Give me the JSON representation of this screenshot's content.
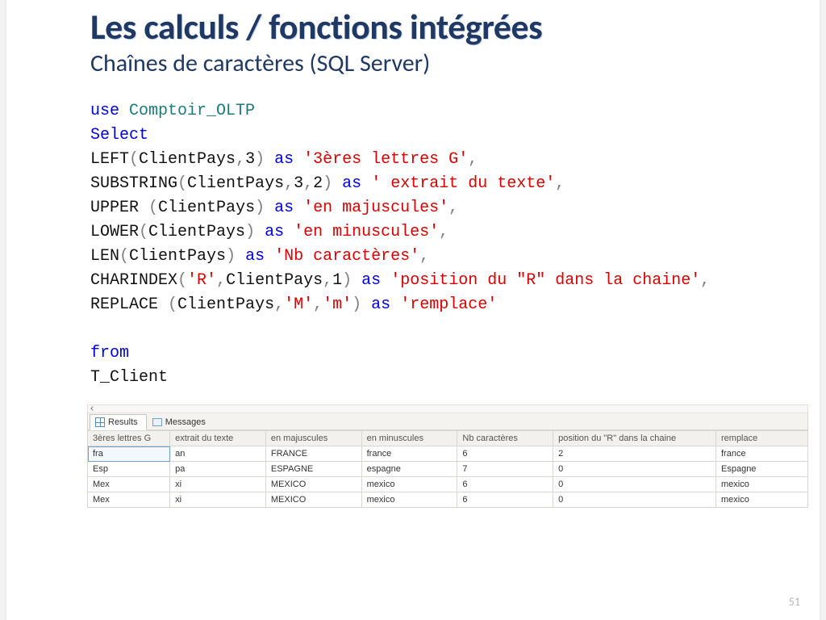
{
  "title": "Les calculs / fonctions intégrées",
  "subtitle": "Chaînes de caractères (SQL Server)",
  "page_number": "51",
  "sql": {
    "use_kw": "use",
    "db": "Comptoir_OLTP",
    "select_kw": "Select",
    "left_fn": "LEFT",
    "col": "ClientPays",
    "n3": "3",
    "as_kw": "as",
    "alias1": "'3ères lettres G'",
    "substr_fn": "SUBSTRING",
    "n3b": "3",
    "n2": "2",
    "alias2": "' extrait du texte'",
    "upper_fn": "UPPER",
    "alias3": "'en majuscules'",
    "lower_fn": "LOWER",
    "alias4": "'en minuscules'",
    "len_fn": "LEN",
    "alias5": "'Nb caractères'",
    "charidx_fn": "CHARINDEX",
    "r_lit": "'R'",
    "n1": "1",
    "alias6": "'position du \"R\" dans la chaine'",
    "replace_fn": "REPLACE",
    "m_up": "'M'",
    "m_lo": "'m'",
    "alias7": "'remplace'",
    "from_kw": "from",
    "table": "T_Client"
  },
  "tabs": {
    "results": "Results",
    "messages": "Messages"
  },
  "grid": {
    "headers": [
      "3ères lettres G",
      "extrait du texte",
      "en majuscules",
      "en minuscules",
      "Nb caractères",
      "position du \"R\" dans la chaine",
      "remplace"
    ],
    "rows": [
      [
        "fra",
        "an",
        "FRANCE",
        "france",
        "6",
        "2",
        "france"
      ],
      [
        "Esp",
        "pa",
        "ESPAGNE",
        "espagne",
        "7",
        "0",
        "Espagne"
      ],
      [
        "Mex",
        "xi",
        "MEXICO",
        "mexico",
        "6",
        "0",
        "mexico"
      ],
      [
        "Mex",
        "xi",
        "MEXICO",
        "mexico",
        "6",
        "0",
        "mexico"
      ]
    ]
  }
}
